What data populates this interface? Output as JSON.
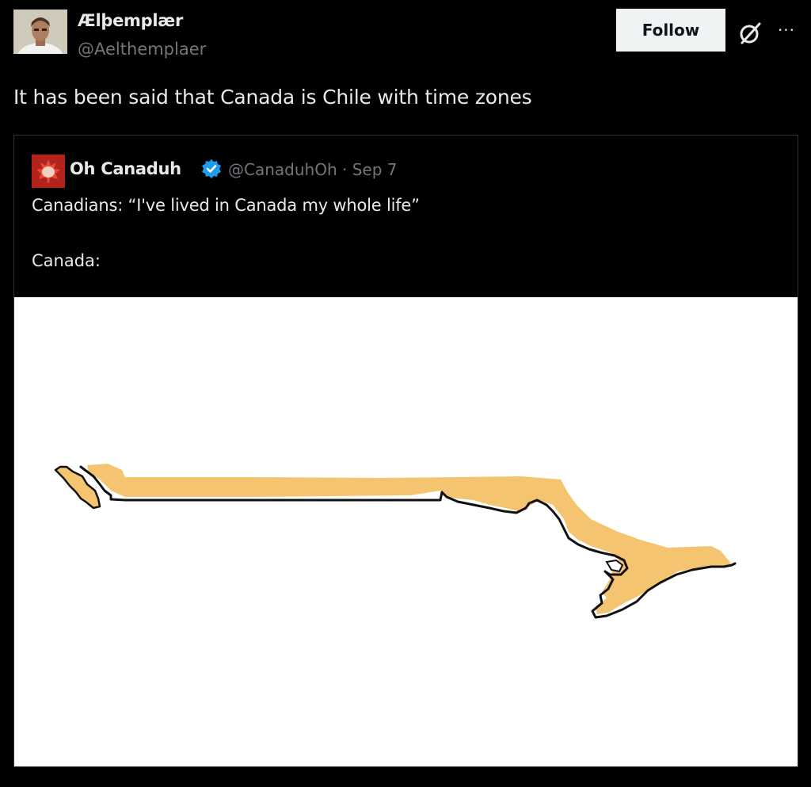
{
  "post": {
    "author": {
      "display_name": "Ælþemplær",
      "handle": "@Aelthemplaer"
    },
    "follow_label": "Follow",
    "more_label": "···",
    "text": "It has been said that Canada is Chile with time zones"
  },
  "quote": {
    "author": {
      "display_name": "Oh Canaduh",
      "handle_date": "@CanaduhOh · Sep 7",
      "verified": true
    },
    "line1": "Canadians: “I've lived in Canada my whole life”",
    "line2": "Canada:",
    "image": {
      "subject": "map-of-canada-stretched-thin",
      "fill_color": "#f5c470",
      "outline_color": "#111111",
      "background": "#ffffff"
    }
  },
  "colors": {
    "background": "#000000",
    "text_primary": "#e7e9ea",
    "text_secondary": "#71767b",
    "verified_blue": "#1d9bf0",
    "follow_bg": "#eff3f4"
  },
  "icons": {
    "grok": "grok-icon",
    "more": "more-icon",
    "verified": "verified-badge-icon"
  }
}
